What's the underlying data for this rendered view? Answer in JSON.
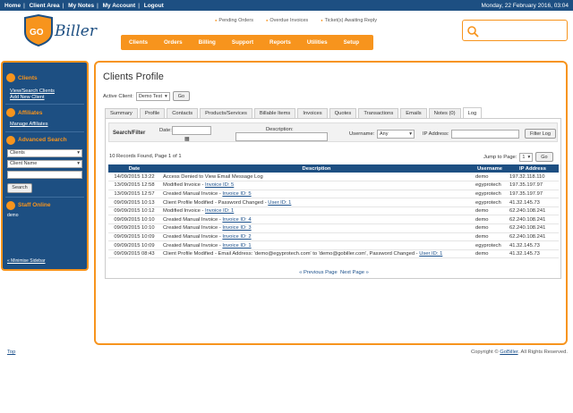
{
  "topbar": {
    "links": [
      "Home",
      "Client Area",
      "My Notes",
      "My Account",
      "Logout"
    ],
    "date": "Monday, 22 February 2016, 03:04"
  },
  "brand": {
    "go": "GO",
    "biller": "Biller"
  },
  "notifications": [
    "Pending Orders",
    "Overdue Invoices",
    "Ticket(s) Awaiting Reply"
  ],
  "nav": [
    "Clients",
    "Orders",
    "Billing",
    "Support",
    "Reports",
    "Utilities",
    "Setup"
  ],
  "sidebar": {
    "clients_title": "Clients",
    "clients_links": [
      "View/Search Clients",
      "Add New Client"
    ],
    "affiliates_title": "Affiliates",
    "affiliates_link": "Manage Affiliates",
    "advsearch_title": "Advanced Search",
    "adv_select1": "Clients",
    "adv_select2": "Client Name",
    "search_button": "Search",
    "staff_title": "Staff Online",
    "staff_name": "demo",
    "minimise": "« Minimise Sidebar"
  },
  "page": {
    "title": "Clients Profile",
    "active_client_label": "Active Client:",
    "active_client_value": "Demo Test",
    "go_button": "Go"
  },
  "tabs": [
    "Summary",
    "Profile",
    "Contacts",
    "Products/Services",
    "Billable Items",
    "Invoices",
    "Quotes",
    "Transactions",
    "Emails",
    "Notes (0)",
    "Log"
  ],
  "filter": {
    "title": "Search/Filter",
    "date_label": "Date:",
    "desc_label": "Description:",
    "user_label": "Username:",
    "user_value": "Any",
    "ip_label": "IP Address:",
    "button": "Filter Log"
  },
  "records": "10 Records Found, Page 1 of 1",
  "jump": {
    "label": "Jump to Page:",
    "value": "1",
    "button": "Go"
  },
  "table": {
    "headers": [
      "Date",
      "Description",
      "Username",
      "IP Address"
    ],
    "rows": [
      {
        "date": "14/09/2015 13:22",
        "desc": "Access Denied to View Email Message Log",
        "link": "",
        "after": "",
        "user": "demo",
        "ip": "197.32.118.110"
      },
      {
        "date": "13/09/2015 12:58",
        "desc": "Modified Invoice - ",
        "link": "Invoice ID: 5",
        "after": "",
        "user": "egyprotech",
        "ip": "197.35.197.97"
      },
      {
        "date": "13/09/2015 12:57",
        "desc": "Created Manual Invoice - ",
        "link": "Invoice ID: 5",
        "after": "",
        "user": "egyprotech",
        "ip": "197.35.197.97"
      },
      {
        "date": "09/09/2015 10:13",
        "desc": "Client Profile Modified - Password Changed - ",
        "link": "User ID: 1",
        "after": "",
        "user": "egyprotech",
        "ip": "41.32.145.73"
      },
      {
        "date": "09/09/2015 10:12",
        "desc": "Modified Invoice - ",
        "link": "Invoice ID: 1",
        "after": "",
        "user": "demo",
        "ip": "62.240.108.241"
      },
      {
        "date": "09/09/2015 10:10",
        "desc": "Created Manual Invoice - ",
        "link": "Invoice ID: 4",
        "after": "",
        "user": "demo",
        "ip": "62.240.108.241"
      },
      {
        "date": "09/09/2015 10:10",
        "desc": "Created Manual Invoice - ",
        "link": "Invoice ID: 3",
        "after": "",
        "user": "demo",
        "ip": "62.240.108.241"
      },
      {
        "date": "09/09/2015 10:09",
        "desc": "Created Manual Invoice - ",
        "link": "Invoice ID: 2",
        "after": "",
        "user": "demo",
        "ip": "62.240.108.241"
      },
      {
        "date": "09/09/2015 10:09",
        "desc": "Created Manual Invoice - ",
        "link": "Invoice ID: 1",
        "after": "",
        "user": "egyprotech",
        "ip": "41.32.145.73"
      },
      {
        "date": "09/09/2015 08:43",
        "desc": "Client Profile Modified - Email Address: 'demo@egyprotech.com' to 'demo@gobiller.com', Password Changed - ",
        "link": "User ID: 1",
        "after": "",
        "user": "demo",
        "ip": "41.32.145.73"
      }
    ]
  },
  "pager": {
    "prev": "« Previous Page",
    "next": "Next Page »"
  },
  "footer": {
    "top": "Top",
    "copyright": "Copyright © ",
    "brand": "GoBiller",
    "rights": ". All Rights Reserved."
  },
  "colors": {
    "navy": "#1d4f82",
    "orange": "#f7941d"
  }
}
